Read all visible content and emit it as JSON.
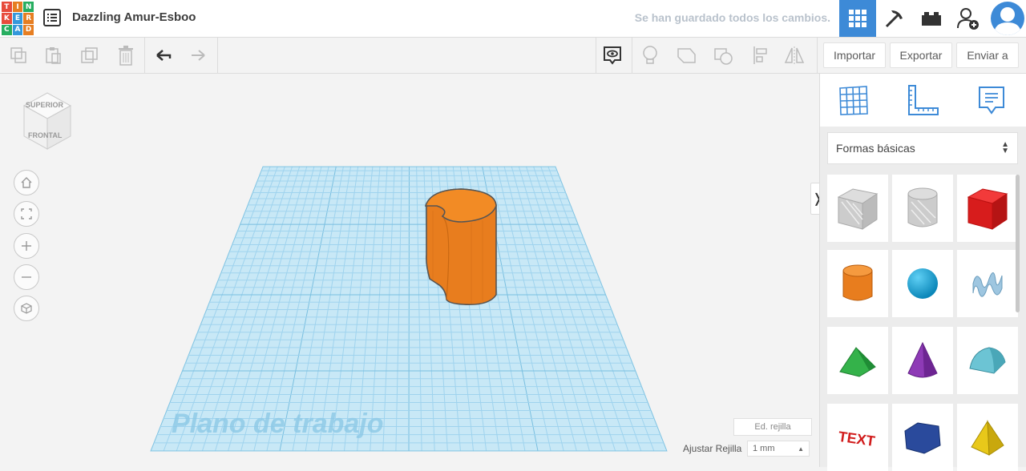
{
  "app": {
    "logo_letters": [
      "T",
      "I",
      "N",
      "K",
      "E",
      "R",
      "C",
      "A",
      "D"
    ],
    "logo_colors": [
      "#e74c3c",
      "#e67e22",
      "#27ae60",
      "#e74c3c",
      "#3498db",
      "#e67e22",
      "#27ae60",
      "#3498db",
      "#e67e22"
    ],
    "title": "Dazzling Amur-Esboo",
    "save_status": "Se han guardado todos los cambios."
  },
  "topbar_icons": [
    "menu-icon",
    "grid-icon",
    "pickaxe-icon",
    "brick-icon",
    "add-user-icon",
    "avatar"
  ],
  "toolbar": {
    "import_label": "Importar",
    "export_label": "Exportar",
    "send_label": "Enviar a"
  },
  "viewcube": {
    "top_label": "SUPERIOR",
    "front_label": "FRONTAL"
  },
  "workplane": {
    "label": "Plano de trabajo",
    "edit_grid_label": "Ed. rejilla",
    "snap_label": "Ajustar Rejilla",
    "snap_value": "1 mm"
  },
  "shapes_panel": {
    "library": "Formas básicas",
    "toggle_glyph": "❭",
    "shapes": [
      "hole-box",
      "hole-cylinder",
      "box",
      "cylinder",
      "sphere",
      "scribble",
      "roof",
      "cone",
      "round-roof",
      "text",
      "polygon",
      "pyramid"
    ],
    "text_shape_label": "TEXT"
  },
  "colors": {
    "accent": "#3d8ad7",
    "object": "#e87d1e",
    "grid": "#9fd3ee"
  }
}
